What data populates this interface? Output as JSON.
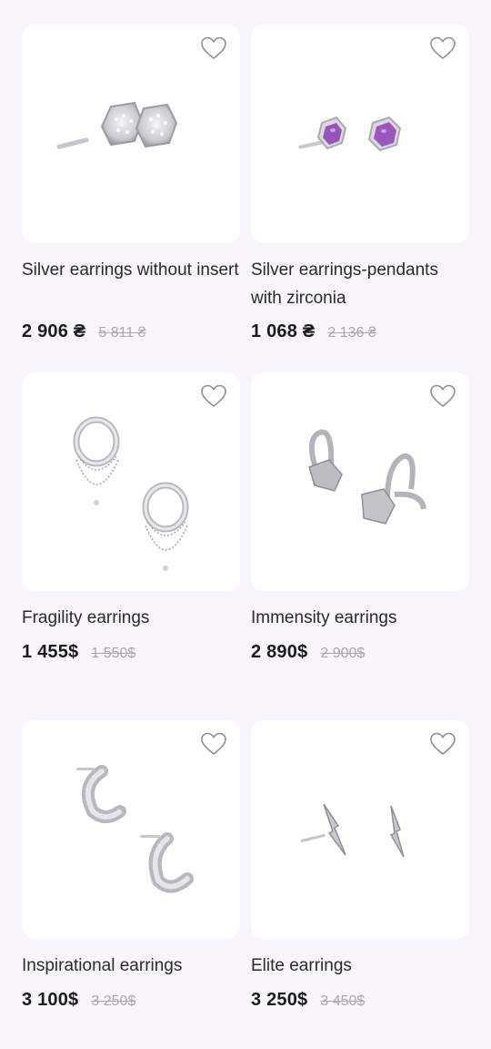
{
  "products": [
    {
      "name": "Silver earrings without insert",
      "price": "2 906 ₴",
      "old_price": "5 811 ₴",
      "image": "hexagon-zircon-studs"
    },
    {
      "name": "Silver earrings-pendants with zirconia",
      "price": "1 068 ₴",
      "old_price": "2 136 ₴",
      "image": "amethyst-hexagon-studs"
    },
    {
      "name": "Fragility earrings",
      "price": "1 455$",
      "old_price": "1 550$",
      "image": "chain-huggie-hoops"
    },
    {
      "name": "Immensity earrings",
      "price": "2 890$",
      "old_price": "2 900$",
      "image": "heart-charm-hoops"
    },
    {
      "name": "Inspirational earrings",
      "price": "3 100$",
      "old_price": "3 250$",
      "image": "pave-huggie-hoops"
    },
    {
      "name": "Elite earrings",
      "price": "3 250$",
      "old_price": "3 450$",
      "image": "lightning-bolt-studs"
    }
  ],
  "icons": {
    "favorite": "heart-outline-icon"
  },
  "colors": {
    "background": "#f8f6fb",
    "card": "#ffffff",
    "old_price": "#a9a7ae"
  }
}
